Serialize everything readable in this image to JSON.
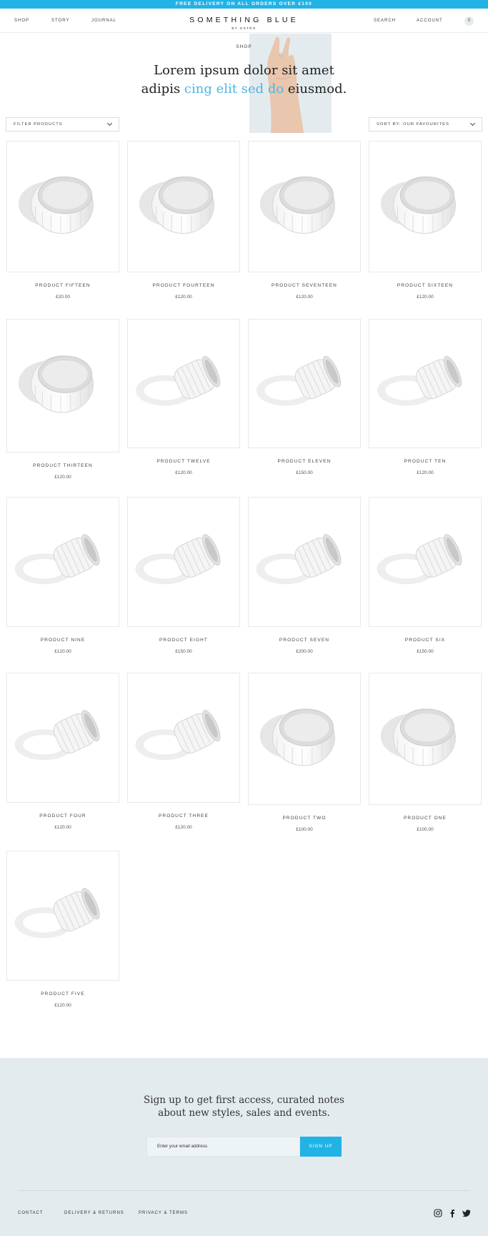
{
  "announcement": "FREE DELIVERY ON ALL ORDERS OVER £100",
  "nav": {
    "left": [
      "SHOP",
      "STORY",
      "JOURNAL"
    ],
    "brand": "SOMETHING BLUE",
    "brand_sub": "BY OSTRO",
    "search": "SEARCH",
    "account": "ACCOUNT",
    "cart_count": "0"
  },
  "hero": {
    "label": "SHOP",
    "line1": "Lorem ipsum dolor sit amet",
    "line2_start": "adipis ",
    "line2_highlight": "cing elit sed do",
    "line2_end": " eiusmod."
  },
  "filter": {
    "label": "FILTER PRODUCTS"
  },
  "sort": {
    "label": "SORT BY: OUR FAVOURITES"
  },
  "products": [
    {
      "name": "PRODUCT FIFTEEN",
      "price": "£20.00",
      "style": "wide"
    },
    {
      "name": "PRODUCT FOURTEEN",
      "price": "£120.00",
      "style": "wide"
    },
    {
      "name": "PRODUCT SEVENTEEN",
      "price": "£120.00",
      "style": "wide"
    },
    {
      "name": "PRODUCT SIXTEEN",
      "price": "£120.00",
      "style": "wide"
    },
    {
      "name": "PRODUCT THIRTEEN",
      "price": "£120.00",
      "style": "wide"
    },
    {
      "name": "PRODUCT TWELVE",
      "price": "£120.00",
      "style": "narrow"
    },
    {
      "name": "PRODUCT ELEVEN",
      "price": "£150.00",
      "style": "narrow"
    },
    {
      "name": "PRODUCT TEN",
      "price": "£120.00",
      "style": "narrow"
    },
    {
      "name": "PRODUCT NINE",
      "price": "£120.00",
      "style": "narrow"
    },
    {
      "name": "PRODUCT EIGHT",
      "price": "£150.00",
      "style": "narrow"
    },
    {
      "name": "PRODUCT SEVEN",
      "price": "£200.00",
      "style": "narrow"
    },
    {
      "name": "PRODUCT SIX",
      "price": "£150.00",
      "style": "narrow"
    },
    {
      "name": "PRODUCT FOUR",
      "price": "£120.00",
      "style": "narrow"
    },
    {
      "name": "PRODUCT THREE",
      "price": "£120.00",
      "style": "narrow"
    },
    {
      "name": "PRODUCT TWO",
      "price": "£100.00",
      "style": "wide"
    },
    {
      "name": "PRODUCT ONE",
      "price": "£100.00",
      "style": "wide"
    },
    {
      "name": "PRODUCT FIVE",
      "price": "£120.00",
      "style": "narrow"
    }
  ],
  "signup": {
    "line1": "Sign up to get first access, curated notes",
    "line2": "about new styles, sales and events.",
    "placeholder": "Enter your email address",
    "button": "SIGN UP"
  },
  "footer": {
    "links": [
      "CONTACT",
      "DELIVERY & RETURNS",
      "PRIVACY & TERMS"
    ],
    "social": [
      "instagram-icon",
      "facebook-icon",
      "twitter-icon"
    ]
  }
}
